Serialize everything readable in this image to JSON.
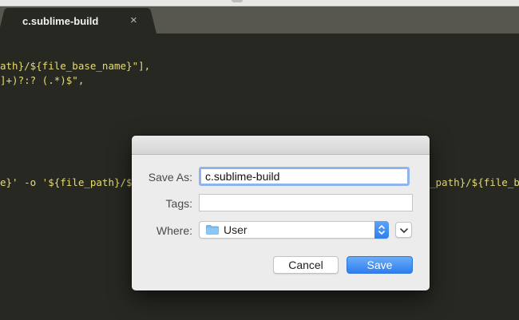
{
  "editor": {
    "tab_title": "c.sublime-build",
    "tab_close_glyph": "×",
    "code_lines": [
      "ath}/${file_base_name}\"],",
      "]+)?:? (.*)$\",",
      "e}' -o '${file_path}/$",
      "_path}/${file_ba"
    ]
  },
  "save_dialog": {
    "save_as_label": "Save As:",
    "save_as_value": "c.sublime-build",
    "tags_label": "Tags:",
    "tags_value": "",
    "where_label": "Where:",
    "where_value": "User",
    "cancel_label": "Cancel",
    "save_label": "Save",
    "icons": {
      "location": "folder-icon",
      "stepper": "up-down-chevron-icon",
      "expand": "chevron-down-icon"
    }
  },
  "colors": {
    "editor_bg": "#272822",
    "tab_bar": "#57574f",
    "code_string": "#e6db74",
    "dialog_bg": "#ececec",
    "accent": "#2f7ef0"
  }
}
